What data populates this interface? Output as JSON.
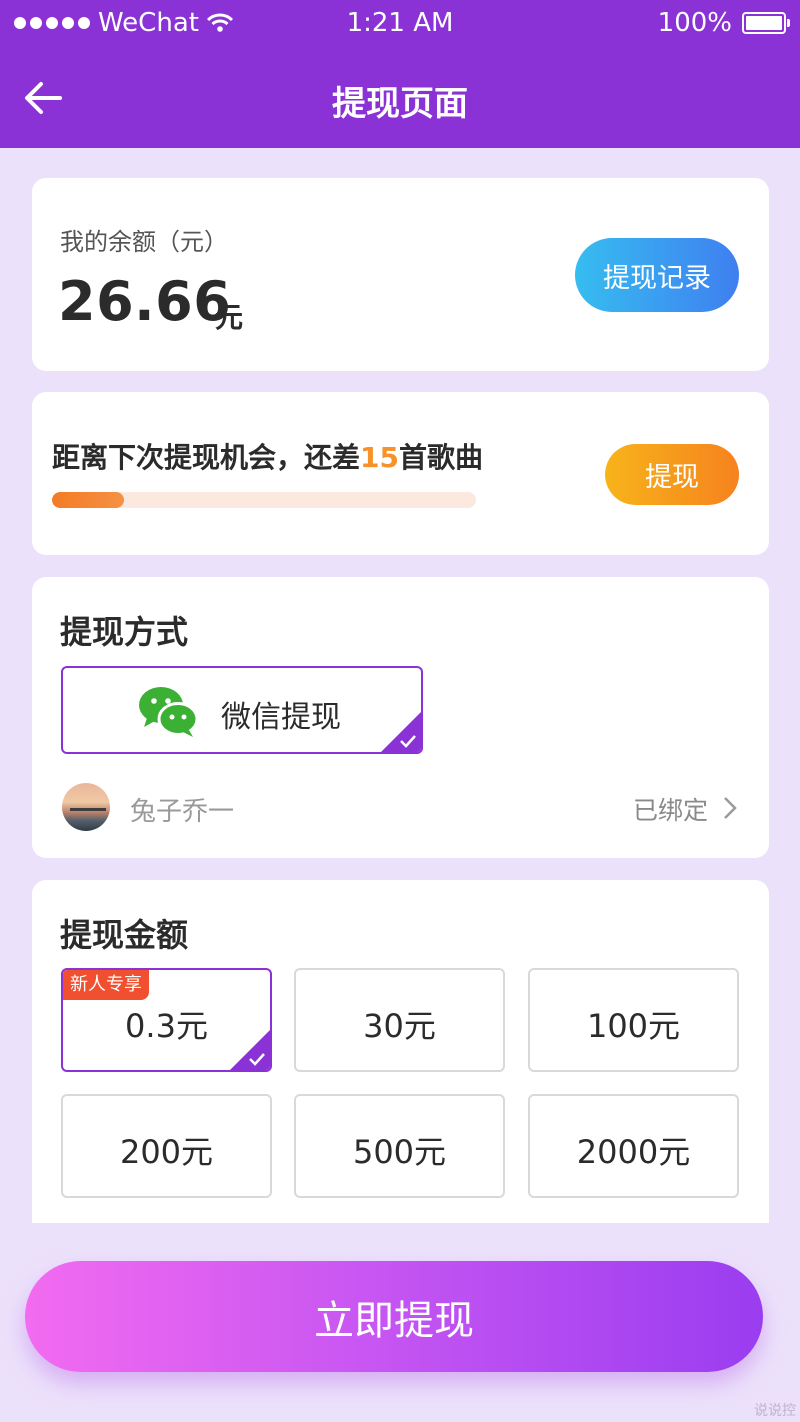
{
  "status_bar": {
    "carrier": "WeChat",
    "time": "1:21 AM",
    "battery": "100%"
  },
  "nav": {
    "title": "提现页面"
  },
  "balance": {
    "label": "我的余额（元）",
    "amount": "26.66",
    "unit": "元",
    "history_button": "提现记录",
    "history_button_colors": [
      "#36bdf0",
      "#3f7ff0"
    ]
  },
  "progress": {
    "text_before": "距离下次提现机会，还差",
    "count": "15",
    "text_after": "首歌曲",
    "value": 0.17,
    "button": "提现",
    "accent": "#f7922a"
  },
  "method": {
    "title": "提现方式",
    "option_label": "微信提现",
    "option_icon": "wechat-icon",
    "account_name": "兔子乔一",
    "account_status": "已绑定"
  },
  "amount_section": {
    "title": "提现金额",
    "options": [
      {
        "label": "0.3元",
        "badge": "新人专享",
        "selected": true
      },
      {
        "label": "30元",
        "badge": "",
        "selected": false
      },
      {
        "label": "100元",
        "badge": "",
        "selected": false
      },
      {
        "label": "200元",
        "badge": "",
        "selected": false
      },
      {
        "label": "500元",
        "badge": "",
        "selected": false
      },
      {
        "label": "2000元",
        "badge": "",
        "selected": false
      }
    ]
  },
  "cta": {
    "label": "立即提现"
  },
  "watermark": "说说控",
  "colors": {
    "primary": "#8a32d6",
    "background": "#ece1fb",
    "orange": "#f7922a",
    "badge": "#f0502f"
  }
}
